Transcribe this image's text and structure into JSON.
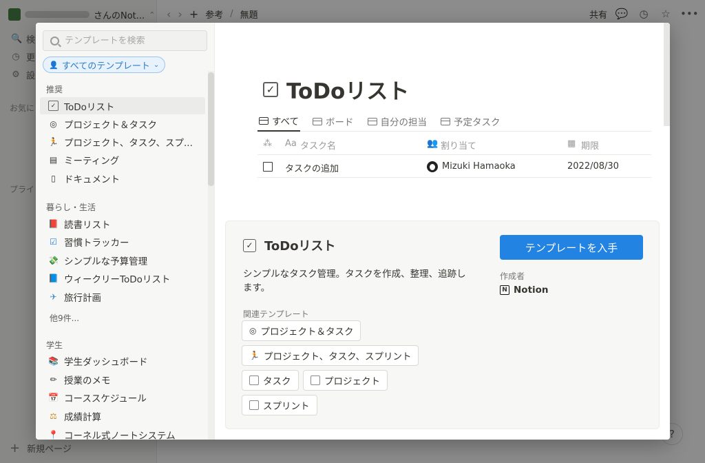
{
  "background": {
    "workspace_suffix": "さんのNot...",
    "sidebar_rows": [
      {
        "icon": "search-icon",
        "glyph": "🔍",
        "label": "検"
      },
      {
        "icon": "clock-icon",
        "glyph": "◷",
        "label": "更"
      },
      {
        "icon": "gear-icon",
        "glyph": "⚙",
        "label": "設"
      }
    ],
    "section_favorites": "お気に",
    "section_private": "プライ",
    "new_page": "新規ページ",
    "breadcrumb_parent": "参考",
    "breadcrumb_current": "無題",
    "share": "共有",
    "help": "?"
  },
  "modal": {
    "search_placeholder": "テンプレートを検索",
    "filter_label": "すべてのテンプレート",
    "categories": [
      {
        "title": "推奨",
        "items": [
          {
            "icon": "checkbox-icon",
            "glyph": "✓",
            "label": "ToDoリスト",
            "active": true
          },
          {
            "icon": "target-icon",
            "glyph": "◎",
            "label": "プロジェクト＆タスク"
          },
          {
            "icon": "runner-icon",
            "glyph": "🏃",
            "label": "プロジェクト、タスク、スプ..."
          },
          {
            "icon": "notes-icon",
            "glyph": "▤",
            "label": "ミーティング"
          },
          {
            "icon": "document-icon",
            "glyph": "▯",
            "label": "ドキュメント"
          }
        ]
      },
      {
        "title": "暮らし・生活",
        "items": [
          {
            "icon": "red-book-icon",
            "glyph": "📕",
            "label": "読書リスト"
          },
          {
            "icon": "blue-check-icon",
            "glyph": "☑",
            "label": "習慣トラッカー"
          },
          {
            "icon": "money-icon",
            "glyph": "💸",
            "label": "シンプルな予算管理"
          },
          {
            "icon": "blue-book-icon",
            "glyph": "📘",
            "label": "ウィークリーToDoリスト"
          },
          {
            "icon": "airplane-icon",
            "glyph": "✈",
            "label": "旅行計画"
          }
        ],
        "more": "他9件..."
      },
      {
        "title": "学生",
        "items": [
          {
            "icon": "books-icon",
            "glyph": "📚",
            "label": "学生ダッシュボード"
          },
          {
            "icon": "pencil-icon",
            "glyph": "✏",
            "label": "授業のメモ"
          },
          {
            "icon": "calendar-icon",
            "glyph": "📅",
            "label": "コーススケジュール"
          },
          {
            "icon": "scales-icon",
            "glyph": "⚖",
            "label": "成績計算"
          },
          {
            "icon": "pin-icon",
            "glyph": "📍",
            "label": "コーネル式ノートシステム"
          }
        ]
      }
    ],
    "preview": {
      "title": "ToDoリスト",
      "views": [
        {
          "label": "すべて",
          "active": true
        },
        {
          "label": "ボード"
        },
        {
          "label": "自分の担当"
        },
        {
          "label": "予定タスク"
        }
      ],
      "columns": {
        "prefix": "Aa",
        "name": "タスク名",
        "assign": "割り当て",
        "due": "期限"
      },
      "row": {
        "name": "タスクの追加",
        "assignee": "Mizuki Hamaoka",
        "due": "2022/08/30"
      }
    },
    "info": {
      "title": "ToDoリスト",
      "get_button": "テンプレートを入手",
      "description": "シンプルなタスク管理。タスクを作成、整理、追跡します。",
      "creator_label": "作成者",
      "creator": "Notion",
      "related_label": "関連テンプレート",
      "related": [
        {
          "icon": "target-icon",
          "glyph": "◎",
          "label": "プロジェクト＆タスク"
        },
        {
          "icon": "runner-icon",
          "glyph": "🏃",
          "label": "プロジェクト、タスク、スプリント"
        },
        {
          "icon": "checkbox-icon",
          "glyph": "",
          "label": "タスク"
        },
        {
          "icon": "checkbox-icon",
          "glyph": "",
          "label": "プロジェクト"
        },
        {
          "icon": "checkbox-icon",
          "glyph": "",
          "label": "スプリント"
        }
      ]
    }
  },
  "colors": {
    "accent": "#2383e2",
    "filter_text": "#2e7bc6"
  }
}
